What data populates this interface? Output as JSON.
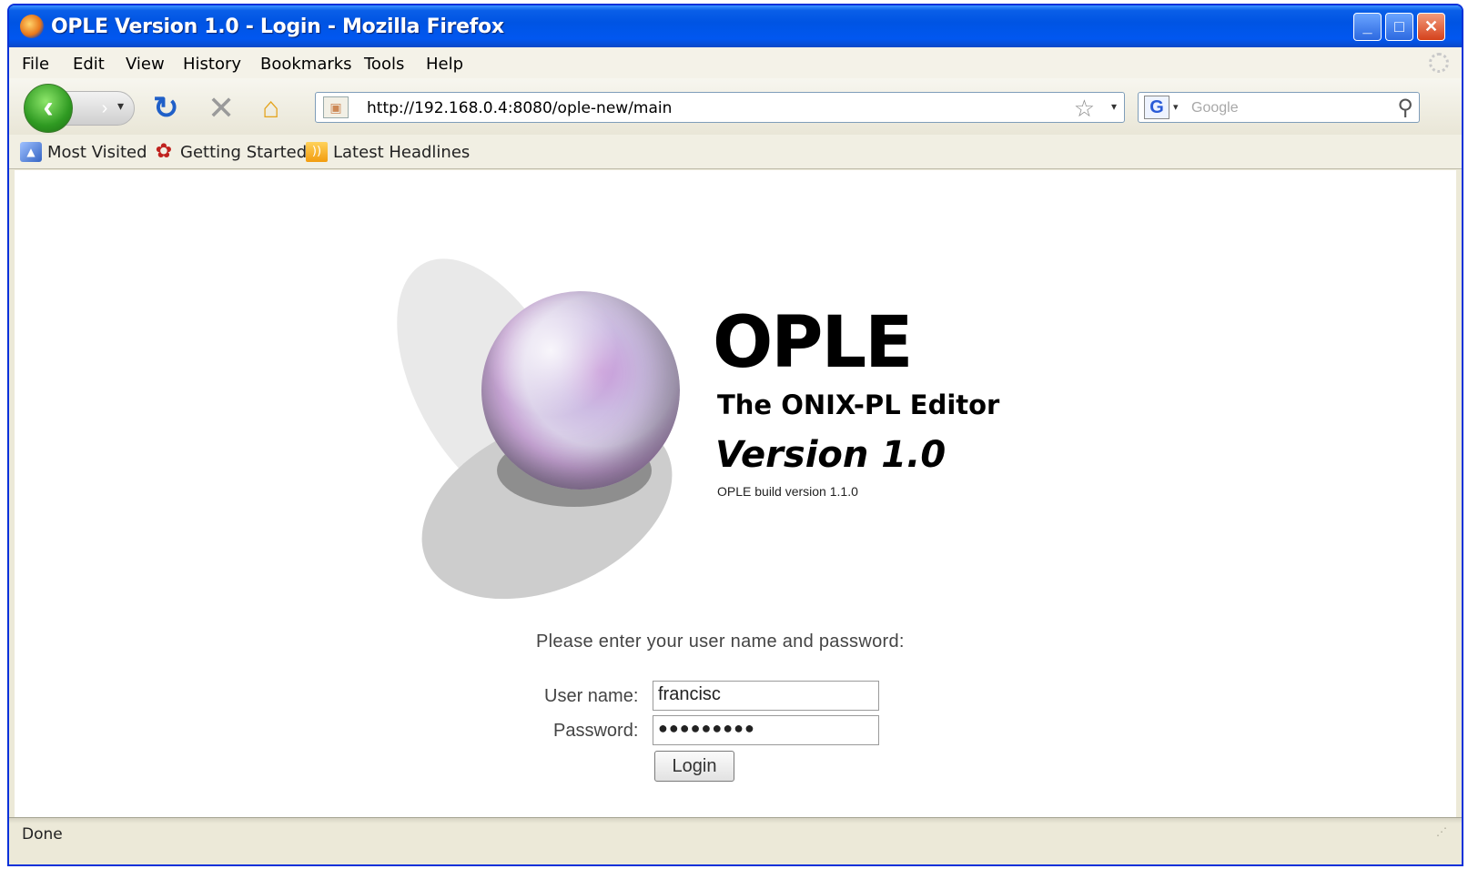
{
  "window": {
    "title": "OPLE Version 1.0 - Login - Mozilla Firefox",
    "controls": {
      "minimize": "_",
      "maximize": "□",
      "close": "✕"
    }
  },
  "menu": [
    "File",
    "Edit",
    "View",
    "History",
    "Bookmarks",
    "Tools",
    "Help"
  ],
  "navigation": {
    "url": "http://192.168.0.4:8080/ople-new/main",
    "search_placeholder": "Google",
    "search_engine_letter": "G"
  },
  "bookmarks": [
    "Most Visited",
    "Getting Started",
    "Latest Headlines"
  ],
  "page": {
    "title": "OPLE",
    "subtitle": "The ONIX-PL Editor",
    "version": "Version 1.0",
    "build": "OPLE build version 1.1.0",
    "prompt": "Please enter your user name and password:",
    "username_label": "User name:",
    "username_value": "francisc",
    "password_label": "Password:",
    "password_value": "●●●●●●●●●",
    "login_button": "Login"
  },
  "status": {
    "text": "Done"
  },
  "colors": {
    "titlebar": "#0054e3",
    "link_blue": "#1f5fc8",
    "back_green": "#2f9a22"
  },
  "icons": [
    "firefox-icon",
    "back-icon",
    "forward-icon",
    "reload-icon",
    "stop-icon",
    "home-icon",
    "bookmark-star-icon",
    "search-icon"
  ]
}
